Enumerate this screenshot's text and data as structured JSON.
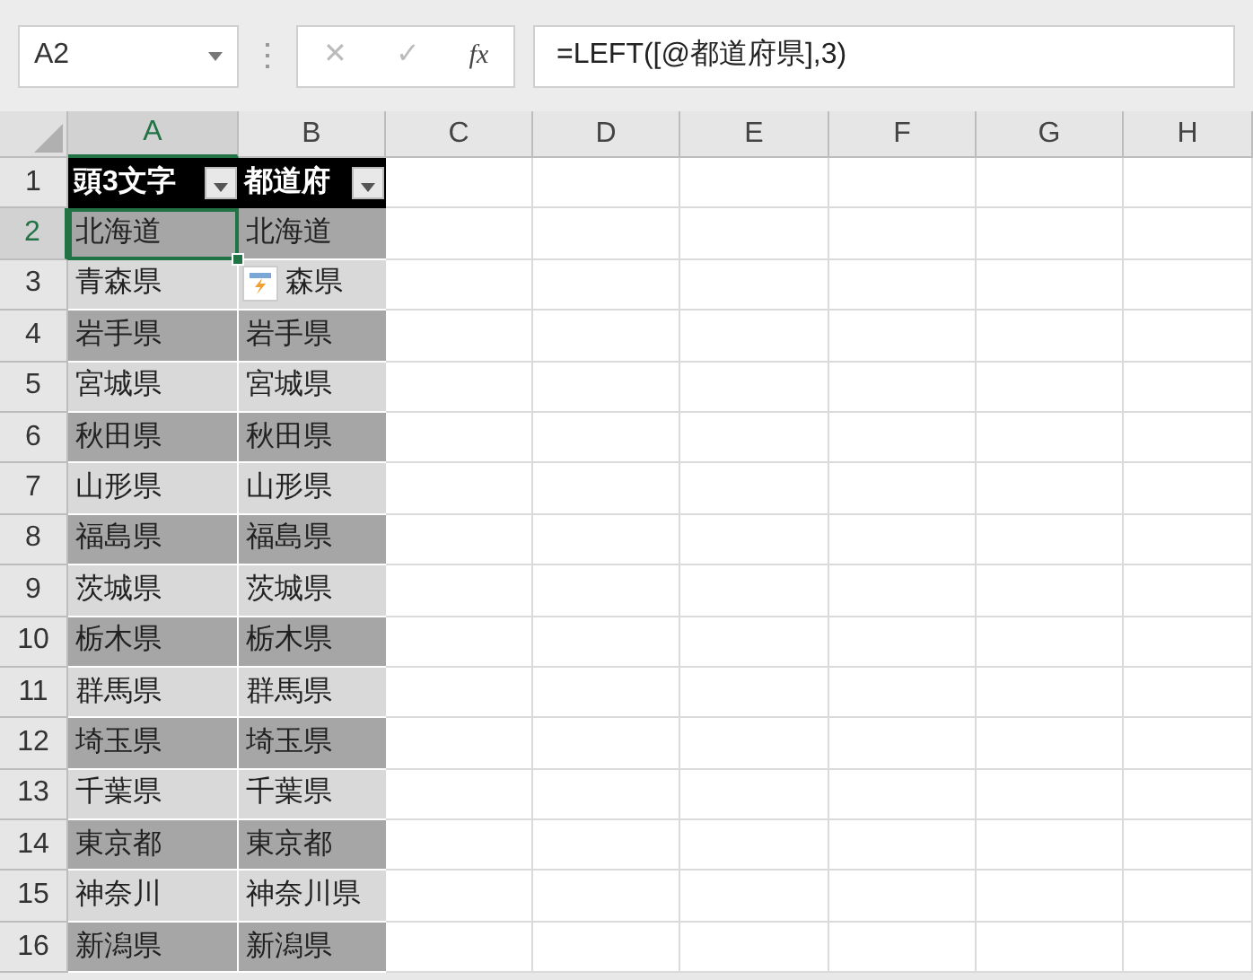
{
  "name_box": {
    "value": "A2"
  },
  "formula_buttons": [
    "✕",
    "✓",
    "fx"
  ],
  "formula": {
    "value": "=LEFT([@都道府県],3)"
  },
  "columns": [
    {
      "label": "A",
      "selected": true
    },
    {
      "label": "B",
      "selected": false
    },
    {
      "label": "C",
      "selected": false
    },
    {
      "label": "D",
      "selected": false
    },
    {
      "label": "E",
      "selected": false
    },
    {
      "label": "F",
      "selected": false
    },
    {
      "label": "G",
      "selected": false
    },
    {
      "label": "H",
      "selected": false
    }
  ],
  "table_headers": [
    "頭3文字",
    "都道府"
  ],
  "rows": [
    {
      "number": "1",
      "selected": false,
      "kind": "header"
    },
    {
      "number": "2",
      "selected": true,
      "kind": "data",
      "a": "北海道",
      "b": "北海道",
      "a_selected": true
    },
    {
      "number": "3",
      "selected": false,
      "kind": "data",
      "a": "青森県",
      "b": "森県",
      "a_selected": false,
      "flash_fill": true
    },
    {
      "number": "4",
      "selected": false,
      "kind": "data",
      "a": "岩手県",
      "b": "岩手県",
      "a_selected": false
    },
    {
      "number": "5",
      "selected": false,
      "kind": "data",
      "a": "宮城県",
      "b": "宮城県",
      "a_selected": false
    },
    {
      "number": "6",
      "selected": false,
      "kind": "data",
      "a": "秋田県",
      "b": "秋田県",
      "a_selected": false
    },
    {
      "number": "7",
      "selected": false,
      "kind": "data",
      "a": "山形県",
      "b": "山形県",
      "a_selected": false
    },
    {
      "number": "8",
      "selected": false,
      "kind": "data",
      "a": "福島県",
      "b": "福島県",
      "a_selected": false
    },
    {
      "number": "9",
      "selected": false,
      "kind": "data",
      "a": "茨城県",
      "b": "茨城県",
      "a_selected": false
    },
    {
      "number": "10",
      "selected": false,
      "kind": "data",
      "a": "栃木県",
      "b": "栃木県",
      "a_selected": false
    },
    {
      "number": "11",
      "selected": false,
      "kind": "data",
      "a": "群馬県",
      "b": "群馬県",
      "a_selected": false
    },
    {
      "number": "12",
      "selected": false,
      "kind": "data",
      "a": "埼玉県",
      "b": "埼玉県",
      "a_selected": false
    },
    {
      "number": "13",
      "selected": false,
      "kind": "data",
      "a": "千葉県",
      "b": "千葉県",
      "a_selected": false
    },
    {
      "number": "14",
      "selected": false,
      "kind": "data",
      "a": "東京都",
      "b": "東京都",
      "a_selected": false
    },
    {
      "number": "15",
      "selected": false,
      "kind": "data",
      "a": "神奈川",
      "b": "神奈川県",
      "a_selected": false
    },
    {
      "number": "16",
      "selected": false,
      "kind": "data",
      "a": "新潟県",
      "b": "新潟県",
      "a_selected": false
    }
  ]
}
